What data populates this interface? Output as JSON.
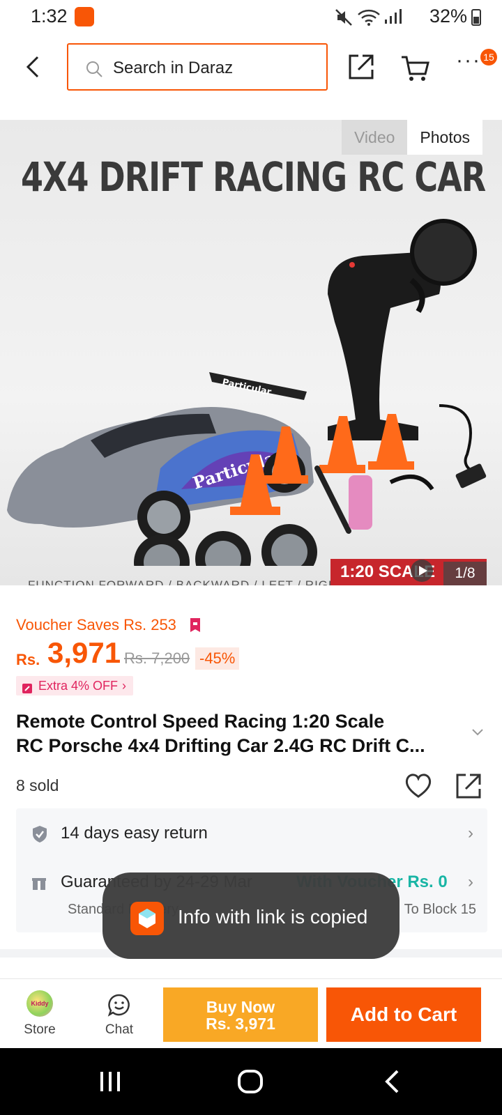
{
  "status_bar": {
    "time": "1:32",
    "battery": "32%"
  },
  "header": {
    "search_placeholder": "Search in Daraz",
    "cart_badge": "15"
  },
  "gallery": {
    "image_title": "4X4 DRIFT RACING RC CAR",
    "tabs": [
      "Video",
      "Photos"
    ],
    "scale_text": "1:20 SCALE",
    "function_text": "FUNCTION FORWARD / BACKWARD / LEFT / RIGHT / DRIFT",
    "counter": "1/8",
    "car_text": "Particular",
    "spoiler_text": "Particular"
  },
  "pricing": {
    "voucher": "Voucher Saves Rs. 253",
    "currency": "Rs.",
    "price": "3,971",
    "original_price": "Rs. 7,200",
    "discount": "-45%",
    "extra": "Extra 4% OFF",
    "extra_arrow": "›"
  },
  "product": {
    "title_line1": "Remote Control Speed Racing 1:20 Scale",
    "title_line2": "RC Porsche 4x4 Drifting Car 2.4G RC Drift C...",
    "sold": "8 sold"
  },
  "service": {
    "return": "14 days easy return",
    "delivery": "Guaranteed by 24-29 Mar",
    "delivery_voucher": "With Voucher Rs. 0",
    "delivery_sub": "Standard Delivery",
    "delivery_loc": "To Block 15",
    "arrow": "›"
  },
  "toast": {
    "text": "Info with link is copied"
  },
  "bottom_bar": {
    "store_label": "Store",
    "store_logo_text": "Kiddy",
    "chat_label": "Chat",
    "buy_now_line1": "Buy Now",
    "buy_now_line2": "Rs. 3,971",
    "add_to_cart": "Add to Cart"
  },
  "colors": {
    "brand": "#f85606",
    "buy_now": "#f9a825",
    "voucher_green": "#19b5a5"
  }
}
